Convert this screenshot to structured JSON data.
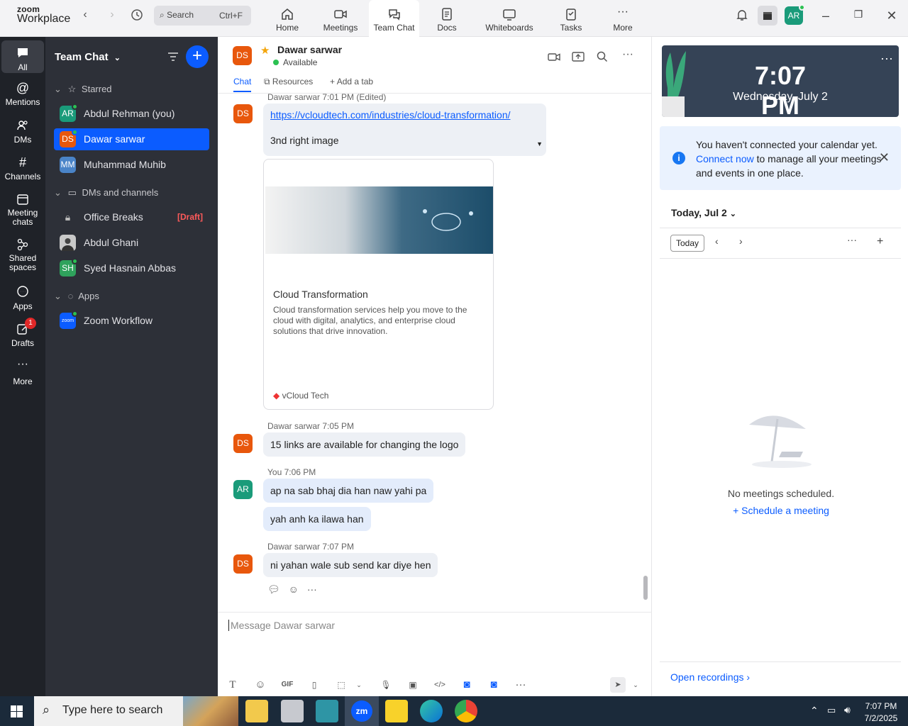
{
  "app": {
    "logo_top": "zoom",
    "logo_bottom": "Workplace"
  },
  "search": {
    "label": "Search",
    "shortcut": "Ctrl+F"
  },
  "top_tabs": [
    {
      "label": "Home"
    },
    {
      "label": "Meetings"
    },
    {
      "label": "Team Chat"
    },
    {
      "label": "Docs"
    },
    {
      "label": "Whiteboards"
    },
    {
      "label": "Tasks"
    },
    {
      "label": "More"
    }
  ],
  "user_avatar": "AR",
  "rail": [
    {
      "label": "All"
    },
    {
      "label": "Mentions"
    },
    {
      "label": "DMs"
    },
    {
      "label": "Channels"
    },
    {
      "label": "Meeting chats"
    },
    {
      "label": "Shared spaces"
    },
    {
      "label": "Apps"
    },
    {
      "label": "Drafts",
      "badge": "1"
    },
    {
      "label": "More"
    }
  ],
  "sidebar": {
    "title": "Team Chat",
    "sections": {
      "starred": "Starred",
      "dms": "DMs and channels",
      "apps": "Apps"
    },
    "starred": [
      {
        "initials": "AR",
        "name": "Abdul Rehman (you)",
        "color": "#1a9b7a"
      },
      {
        "initials": "DS",
        "name": "Dawar sarwar",
        "color": "#e8570c"
      },
      {
        "initials": "MM",
        "name": "Muhammad Muhib",
        "color": "#4a84c8"
      }
    ],
    "dms": [
      {
        "name": "Office Breaks",
        "draft": "[Draft]"
      },
      {
        "name": "Abdul Ghani"
      },
      {
        "initials": "SH",
        "name": "Syed Hasnain Abbas",
        "color": "#2fa25c"
      }
    ],
    "apps": [
      {
        "initials": "zoom",
        "name": "Zoom Workflow",
        "color": "#0b5cff"
      }
    ]
  },
  "chat": {
    "avatar": "DS",
    "name": "Dawar sarwar",
    "status": "Available",
    "tabs": [
      "Chat",
      "Resources",
      "Add a tab"
    ],
    "messages": [
      {
        "sender": "Dawar sarwar",
        "time": "7:01 PM (Edited)",
        "link": "https://vcloudtech.com/industries/cloud-transformation/",
        "text": "3nd right image"
      },
      {
        "sender": "Dawar sarwar",
        "time": "7:05 PM",
        "text": "15 links are available for changing the logo"
      },
      {
        "sender": "You",
        "time": "7:06 PM",
        "text": "ap na sab bhaj dia han naw yahi pa",
        "text2": "yah  anh ka ilawa han"
      },
      {
        "sender": "Dawar sarwar",
        "time": "7:07 PM",
        "text": "ni yahan wale sub send kar diye hen"
      }
    ],
    "card": {
      "title": "Cloud Transformation",
      "description": "Cloud transformation services help you move to the cloud with digital, analytics, and enterprise cloud solutions that drive innovation.",
      "site": "vCloud Tech"
    },
    "composer_placeholder": "Message Dawar sarwar",
    "gif_label": "GIF"
  },
  "calendar": {
    "time": "7:07 PM",
    "date": "Wednesday, July 2",
    "notice_pre": "You haven't connected your calendar yet.",
    "notice_link": "Connect now",
    "notice_post": "to manage all your meetings and events in one place.",
    "today_label": "Today, Jul 2",
    "today_button": "Today",
    "empty": "No meetings scheduled.",
    "schedule": "Schedule a meeting",
    "recordings": "Open recordings"
  },
  "taskbar": {
    "search": "Type here to search",
    "time": "7:07 PM",
    "date": "7/2/2025"
  }
}
